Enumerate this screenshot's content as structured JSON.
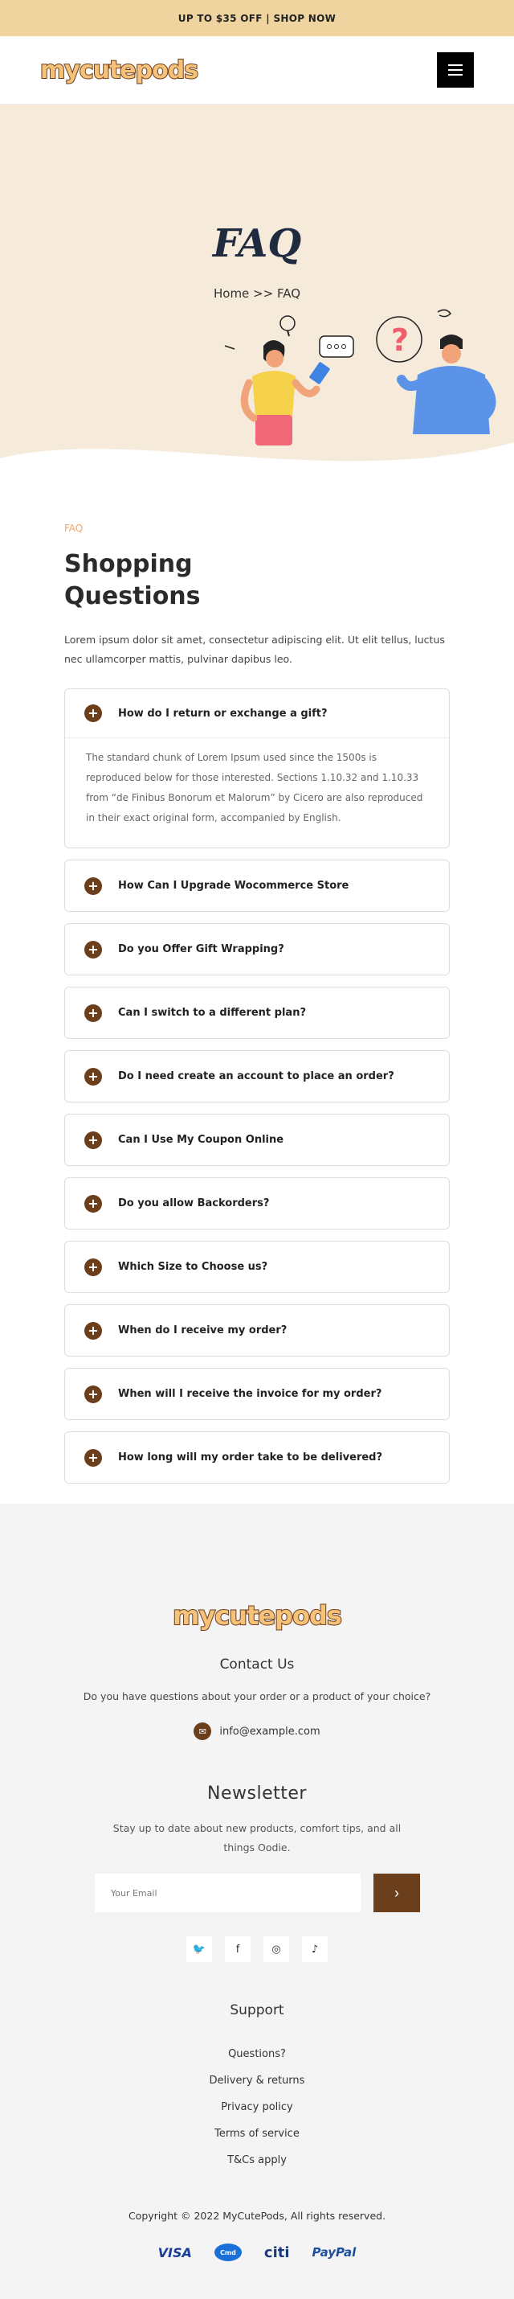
{
  "announcement": "UP TO $35 OFF | SHOP NOW",
  "header": {
    "logo": "mycutepods"
  },
  "hero": {
    "title": "FAQ",
    "breadcrumb": "Home >> FAQ"
  },
  "faq": {
    "eyebrow": "FAQ",
    "title_line1": "Shopping",
    "title_line2": "Questions",
    "intro": "Lorem ipsum dolor sit amet, consectetur adipiscing elit. Ut elit tellus, luctus nec ullamcorper mattis, pulvinar dapibus leo.",
    "items": [
      {
        "q": "How do I return or exchange a gift?",
        "a": "The standard chunk of Lorem Ipsum used since the 1500s is reproduced below for those interested. Sections 1.10.32 and 1.10.33 from “de Finibus Bonorum et Malorum” by Cicero are also reproduced in their exact original form, accompanied by English."
      },
      {
        "q": "How Can I Upgrade Wocommerce Store"
      },
      {
        "q": "Do you Offer Gift Wrapping?"
      },
      {
        "q": "Can I switch to a different plan?"
      },
      {
        "q": "Do I need create an account to place an order?"
      },
      {
        "q": "Can I Use My Coupon Online"
      },
      {
        "q": "Do you allow Backorders?"
      },
      {
        "q": "Which Size to Choose us?"
      },
      {
        "q": "When do I receive my order?"
      },
      {
        "q": "When will I receive the invoice for my order?"
      },
      {
        "q": "How long will my order take to be delivered?"
      }
    ],
    "plus_symbol": "+"
  },
  "footer": {
    "logo": "mycutepods",
    "contact_title": "Contact Us",
    "contact_text": "Do you have questions about your order or a product of your choice?",
    "email": "info@example.com",
    "newsletter_title": "Newsletter",
    "newsletter_text": "Stay up to date about new products, comfort tips, and all things Oodie.",
    "email_placeholder": "Your Email",
    "submit_symbol": "›",
    "socials": [
      {
        "icon": "twitter-icon",
        "glyph": "🐦"
      },
      {
        "icon": "facebook-icon",
        "glyph": "f"
      },
      {
        "icon": "instagram-icon",
        "glyph": "◎"
      },
      {
        "icon": "tiktok-icon",
        "glyph": "♪"
      }
    ],
    "support_title": "Support",
    "support_links": [
      "Questions?",
      "Delivery & returns",
      "Privacy policy",
      "Terms of service",
      "T&Cs apply"
    ],
    "copyright": "Copyright © 2022 MyCutePods, All rights reserved.",
    "payments": [
      "VISA",
      "Cmd",
      "citi",
      "PayPal"
    ]
  },
  "colors": {
    "brand": "#6b3e1c",
    "accent": "#f0d4a0",
    "hero_bg": "#f6eadb",
    "footer_bg": "#f4f4f4"
  }
}
